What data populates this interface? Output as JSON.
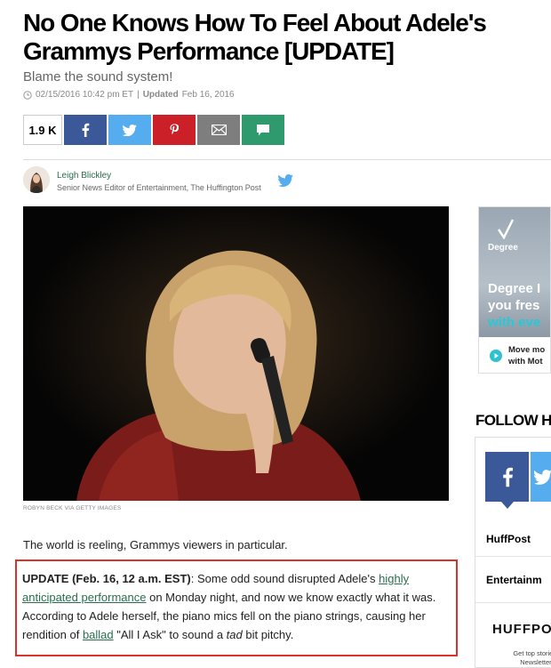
{
  "article": {
    "headline": "No One Knows How To Feel About Adele's Grammys Performance [UPDATE]",
    "subhead": "Blame the sound system!",
    "published": "02/15/2016 10:42 pm ET",
    "separator": "|",
    "updated_label": "Updated",
    "updated_date": "Feb 16, 2016"
  },
  "share": {
    "count": "1.9 K",
    "buttons": [
      "facebook-icon",
      "twitter-icon",
      "pinterest-icon",
      "email-icon",
      "comment-icon"
    ]
  },
  "author": {
    "name": "Leigh Blickley",
    "title": "Senior News Editor of Entertainment, The Huffington Post"
  },
  "hero": {
    "credit": "ROBYN BECK VIA GETTY IMAGES"
  },
  "body": {
    "para1": "The world is reeling, Grammys viewers in particular.",
    "update_label": "UPDATE (Feb. 16, 12 a.m. EST)",
    "update_t1": ": Some odd sound disrupted Adele's ",
    "update_link1": "highly anticipated performance",
    "update_t2": " on Monday night, and now we know exactly what it was. According to Adele herself, the piano mics fell on the piano strings, causing her rendition of ",
    "update_link2": "ballad",
    "update_t3": " \"All I Ask\" to sound a ",
    "update_em": "tad",
    "update_t4": " bit pitchy."
  },
  "ad": {
    "brand": "Degree",
    "headline_l1": "Degree I",
    "headline_l2": "you fres",
    "headline_l3": "with eve",
    "cta_l1": "Move mo",
    "cta_l2": "with Mot"
  },
  "follow": {
    "title": "FOLLOW H",
    "item1": "HuffPost",
    "item2": "Entertainm",
    "logo": "HUFFPOS",
    "newsletter_l1": "Get top stories and",
    "newsletter_l2": "Newsletters m"
  },
  "colors": {
    "facebook": "#3b5998",
    "twitter": "#55acee",
    "pinterest": "#cb2027",
    "email": "#7e7e7e",
    "comment": "#2e9a6e",
    "link": "#2a6e4e",
    "highlight_box": "#d9342b"
  }
}
